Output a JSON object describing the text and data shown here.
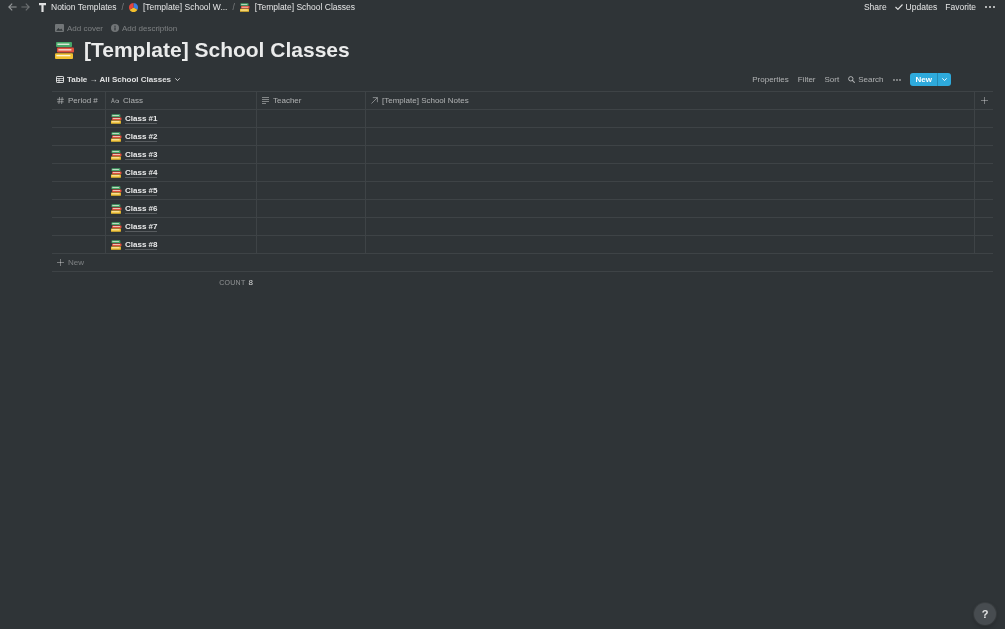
{
  "topbar": {
    "breadcrumbs": [
      {
        "kind": "workspace",
        "label": "Notion Templates"
      },
      {
        "kind": "separator",
        "label": "/"
      },
      {
        "kind": "page",
        "label": "[Template] School W..."
      },
      {
        "kind": "separator",
        "label": "/"
      },
      {
        "kind": "database",
        "label": "[Template] School Classes"
      }
    ],
    "actions": [
      {
        "kind": "text",
        "label": "Share"
      },
      {
        "kind": "check",
        "label": "Updates"
      },
      {
        "kind": "text",
        "label": "Favorite"
      },
      {
        "kind": "more"
      }
    ]
  },
  "page": {
    "add_cover": "Add cover",
    "add_description": "Add description",
    "title": "[Template] School Classes"
  },
  "view": {
    "label": "Table → All School Classes",
    "toolbar": [
      {
        "kind": "text",
        "label": "Properties"
      },
      {
        "kind": "text",
        "label": "Filter"
      },
      {
        "kind": "text",
        "label": "Sort"
      },
      {
        "kind": "search",
        "label": "Search"
      },
      {
        "kind": "more"
      },
      {
        "kind": "new",
        "label": "New"
      }
    ]
  },
  "table": {
    "columns": [
      {
        "kind": "number",
        "label": "Period #"
      },
      {
        "kind": "title",
        "label": "Class"
      },
      {
        "kind": "text",
        "label": "Teacher"
      },
      {
        "kind": "relation",
        "label": "[Template] School Notes"
      }
    ],
    "rows": [
      {
        "class": "Class #1"
      },
      {
        "class": "Class #2"
      },
      {
        "class": "Class #3"
      },
      {
        "class": "Class #4"
      },
      {
        "class": "Class #5"
      },
      {
        "class": "Class #6"
      },
      {
        "class": "Class #7"
      },
      {
        "class": "Class #8"
      }
    ],
    "new_row": "New",
    "footer": {
      "count_label": "COUNT",
      "count": "8"
    }
  },
  "help": "?"
}
